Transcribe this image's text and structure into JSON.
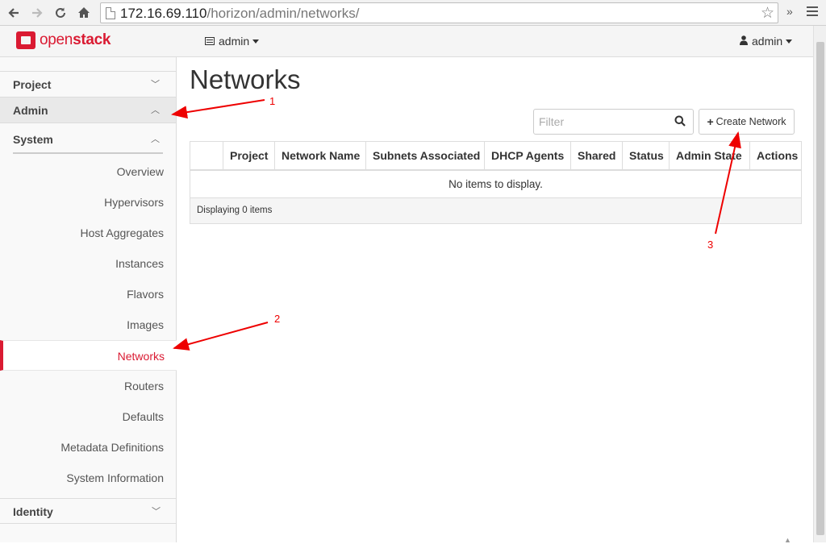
{
  "browser": {
    "url_host": "172.16.69.110",
    "url_path": "/horizon/admin/networks/",
    "back_icon": "arrow-left-icon",
    "forward_icon": "arrow-right-icon",
    "reload_icon": "reload-icon",
    "home_icon": "home-icon",
    "bookmark_icon": "star-icon",
    "extensions_label": "»"
  },
  "navbar": {
    "logo_prefix": "open",
    "logo_suffix": "stack",
    "project_label": "admin",
    "user_label": "admin",
    "brand_color": "#da1a32"
  },
  "sidebar": {
    "dashboards": [
      {
        "label": "Project",
        "expanded": false
      },
      {
        "label": "Admin",
        "expanded": true
      },
      {
        "label": "Identity",
        "expanded": false
      }
    ],
    "panel_group": "System",
    "items": [
      {
        "label": "Overview"
      },
      {
        "label": "Hypervisors"
      },
      {
        "label": "Host Aggregates"
      },
      {
        "label": "Instances"
      },
      {
        "label": "Flavors"
      },
      {
        "label": "Images"
      },
      {
        "label": "Networks",
        "active": true
      },
      {
        "label": "Routers"
      },
      {
        "label": "Defaults"
      },
      {
        "label": "Metadata Definitions"
      },
      {
        "label": "System Information"
      }
    ]
  },
  "main": {
    "title": "Networks",
    "filter_placeholder": "Filter",
    "create_button_label": "Create Network",
    "table": {
      "columns": [
        "",
        "Project",
        "Network Name",
        "Subnets Associated",
        "DHCP Agents",
        "Shared",
        "Status",
        "Admin State",
        "Actions"
      ],
      "empty_message": "No items to display.",
      "footer": "Displaying 0 items"
    }
  },
  "annotations": {
    "labels": [
      "1",
      "2",
      "3"
    ],
    "color": "#e00000"
  }
}
